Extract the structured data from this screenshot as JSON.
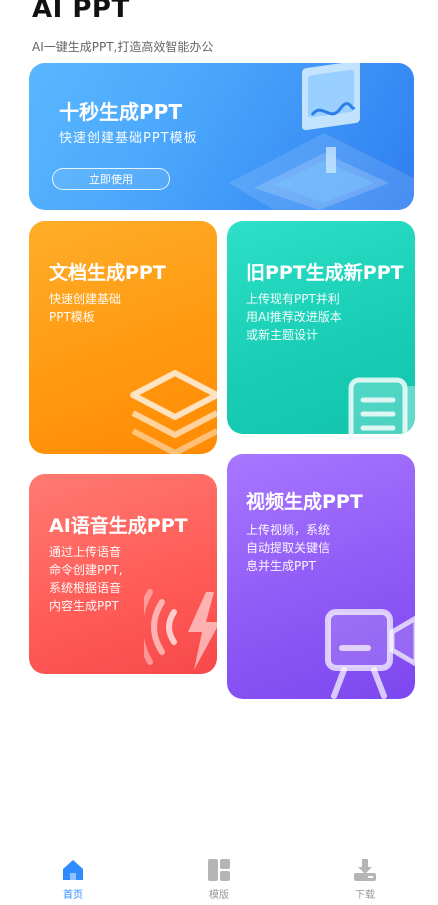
{
  "header": {
    "title": "AI PPT",
    "subtitle": "AI一键生成PPT,打造高效智能办公"
  },
  "banner": {
    "title": "十秒生成PPT",
    "desc": "快速创建基础PPT模板",
    "button": "立即使用"
  },
  "cards": {
    "doc": {
      "title": "文档生成PPT",
      "desc": "快速创建基础\nPPT模板"
    },
    "old": {
      "title": "旧PPT生成新PPT",
      "desc": "上传现有PPT并利\n用AI推荐改进版本\n或新主题设计"
    },
    "voice": {
      "title": "AI语音生成PPT",
      "desc": "通过上传语音\n命令创建PPT,\n系统根据语音\n内容生成PPT"
    },
    "video": {
      "title": "视频生成PPT",
      "desc": "上传视频，系统\n自动提取关键信\n息并生成PPT"
    }
  },
  "nav": {
    "home": "首页",
    "templates": "模版",
    "download": "下载"
  },
  "colors": {
    "active": "#2f8bff",
    "inactive": "#999999"
  },
  "icons": {
    "home": "home-icon",
    "templates": "templates-icon",
    "download": "download-icon"
  }
}
